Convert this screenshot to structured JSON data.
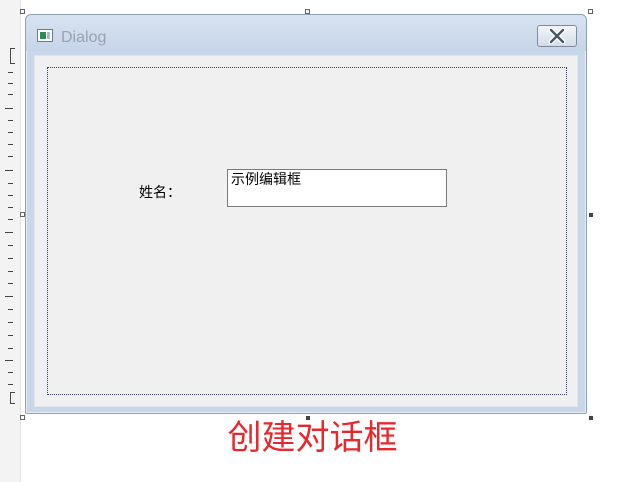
{
  "dialog": {
    "title": "Dialog",
    "close_icon": "close-icon",
    "app_icon": "window-app-icon"
  },
  "form": {
    "name_label": "姓名：",
    "edit_value": "示例编辑框"
  },
  "caption": {
    "text": "创建对话框",
    "color": "#e8282d"
  }
}
